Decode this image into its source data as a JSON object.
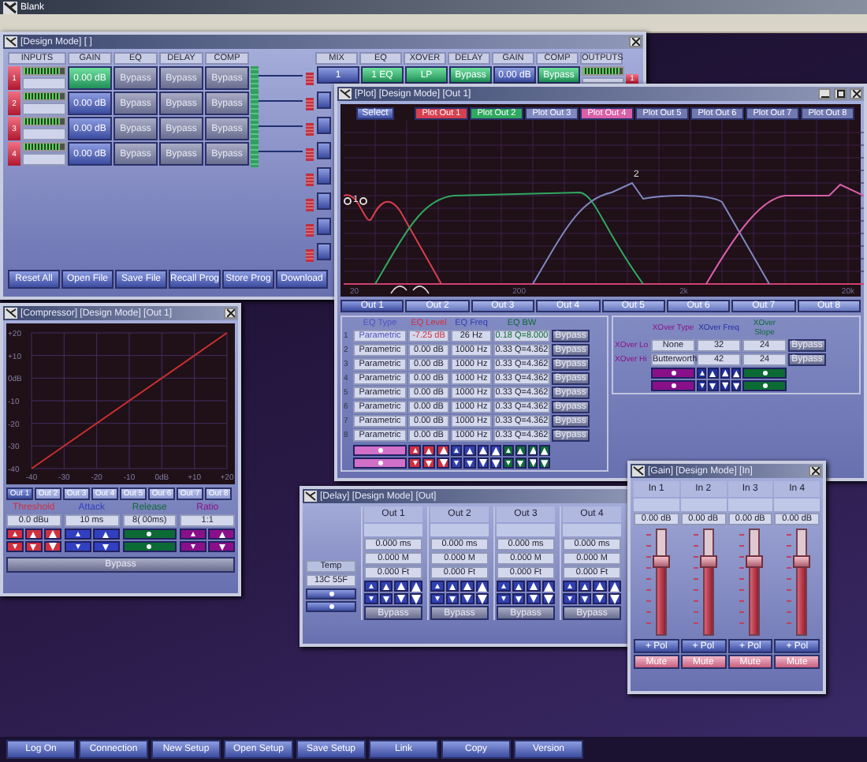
{
  "app_title": "Blank",
  "design": {
    "title": "[Design Mode] [ ]",
    "input_headers": [
      "INPUTS",
      "GAIN",
      "EQ",
      "DELAY",
      "COMP"
    ],
    "output_headers": [
      "MIX",
      "EQ",
      "XOVER",
      "DELAY",
      "GAIN",
      "COMP",
      "OUTPUTS"
    ],
    "inputs": [
      {
        "number": "1",
        "level": 0.9,
        "gain": "0.00 dB",
        "selected": true,
        "eq": "Bypass",
        "delay": "Bypass",
        "comp": "Bypass"
      },
      {
        "number": "2",
        "level": 0.9,
        "gain": "0.00 dB",
        "selected": false,
        "eq": "Bypass",
        "delay": "Bypass",
        "comp": "Bypass"
      },
      {
        "number": "3",
        "level": 0.9,
        "gain": "0.00 dB",
        "selected": false,
        "eq": "Bypass",
        "delay": "Bypass",
        "comp": "Bypass"
      },
      {
        "number": "4",
        "level": 0.9,
        "gain": "0.00 dB",
        "selected": false,
        "eq": "Bypass",
        "delay": "Bypass",
        "comp": "Bypass"
      }
    ],
    "output": {
      "mix": "1",
      "eq": "1 EQ",
      "xover": "LP",
      "delay": "Bypass",
      "gain": "0.00 dB",
      "comp": "Bypass",
      "level": 0.9,
      "number": "1"
    },
    "buttons": [
      "Reset All",
      "Open File",
      "Save File",
      "Recall Prog",
      "Store Prog",
      "Download"
    ]
  },
  "plot": {
    "title": "[Plot] [Design Mode] [Out 1]",
    "select": "Select",
    "plot_buttons": [
      {
        "label": "Plot Out 1",
        "color": "#d84050"
      },
      {
        "label": "Plot Out 2",
        "color": "#30a860"
      },
      {
        "label": "Plot Out 3",
        "color": "#8088c0"
      },
      {
        "label": "Plot Out 4",
        "color": "#d860a8"
      },
      {
        "label": "Plot Out 5",
        "color": "#7078b0"
      },
      {
        "label": "Plot Out 6",
        "color": "#7078b0"
      },
      {
        "label": "Plot Out 7",
        "color": "#7078b0"
      },
      {
        "label": "Plot Out 8",
        "color": "#7078b0"
      }
    ],
    "x_labels": [
      "20",
      "200",
      "2k",
      "20k"
    ],
    "point_labels": [
      "1",
      "2"
    ],
    "out_tabs": [
      {
        "label": "Out 1",
        "selected": true
      },
      {
        "label": "Out 2",
        "selected": false
      },
      {
        "label": "Out 3",
        "selected": false
      },
      {
        "label": "Out 4",
        "selected": false
      },
      {
        "label": "Out 5",
        "selected": false
      },
      {
        "label": "Out 6",
        "selected": false
      },
      {
        "label": "Out 7",
        "selected": false
      },
      {
        "label": "Out 8",
        "selected": false
      }
    ],
    "eq_headers": [
      {
        "label": "EQ Type",
        "color": "#5050c0"
      },
      {
        "label": "EQ Level",
        "color": "#d03040"
      },
      {
        "label": "EQ Freq",
        "color": "#3040b0"
      },
      {
        "label": "EQ BW",
        "color": "#0c6a34"
      }
    ],
    "eq_rows": [
      {
        "number": "1",
        "type": "Parametric",
        "level": "-7.25 dB",
        "freq": "26 Hz",
        "bw": "0.18 Q=8.000",
        "bypass": "Bypass",
        "selected": true
      },
      {
        "number": "2",
        "type": "Parametric",
        "level": "0.00 dB",
        "freq": "1000 Hz",
        "bw": "0.33 Q=4.362",
        "bypass": "Bypass",
        "selected": false
      },
      {
        "number": "3",
        "type": "Parametric",
        "level": "0.00 dB",
        "freq": "1000 Hz",
        "bw": "0.33 Q=4.362",
        "bypass": "Bypass",
        "selected": false
      },
      {
        "number": "4",
        "type": "Parametric",
        "level": "0.00 dB",
        "freq": "1000 Hz",
        "bw": "0.33 Q=4.362",
        "bypass": "Bypass",
        "selected": false
      },
      {
        "number": "5",
        "type": "Parametric",
        "level": "0.00 dB",
        "freq": "1000 Hz",
        "bw": "0.33 Q=4.362",
        "bypass": "Bypass",
        "selected": false
      },
      {
        "number": "6",
        "type": "Parametric",
        "level": "0.00 dB",
        "freq": "1000 Hz",
        "bw": "0.33 Q=4.362",
        "bypass": "Bypass",
        "selected": false
      },
      {
        "number": "7",
        "type": "Parametric",
        "level": "0.00 dB",
        "freq": "1000 Hz",
        "bw": "0.33 Q=4.362",
        "bypass": "Bypass",
        "selected": false
      },
      {
        "number": "8",
        "type": "Parametric",
        "level": "0.00 dB",
        "freq": "1000 Hz",
        "bw": "0.33 Q=4.362",
        "bypass": "Bypass",
        "selected": false
      }
    ],
    "xover_headers": [
      {
        "label": "XOver Type",
        "color": "#8a108a"
      },
      {
        "label": "XOver Freq",
        "color": "#2030a0"
      },
      {
        "label": "XOver Slope",
        "color": "#0c6a34"
      }
    ],
    "xover_rows": [
      {
        "label": "XOver Lo",
        "type": "None",
        "freq": "32",
        "slope": "24",
        "bypass": "Bypass"
      },
      {
        "label": "XOver Hi",
        "type": "Butterworth",
        "freq": "42",
        "slope": "24",
        "bypass": "Bypass"
      }
    ]
  },
  "compressor": {
    "title": "[Compressor] [Design Mode] [Out 1]",
    "chart_data": {
      "type": "line",
      "grid": true,
      "x": [
        -40,
        20
      ],
      "series": [
        {
          "color": "#c83030",
          "values": [
            -40,
            20
          ]
        }
      ],
      "xlim": [
        -40,
        20
      ],
      "ylim": [
        -40,
        20
      ],
      "xticks": [
        -40,
        -30,
        -20,
        -10,
        {
          "value": 0,
          "label": "0dB"
        },
        {
          "value": 10,
          "label": "+10"
        },
        {
          "value": 20,
          "label": "+20"
        }
      ],
      "yticks": [
        {
          "value": 20,
          "label": "+20"
        },
        {
          "value": 10,
          "label": "+10"
        },
        {
          "value": 0,
          "label": "0dB"
        },
        -10,
        -20,
        -30,
        -40
      ]
    },
    "out_tabs": [
      {
        "label": "Out 1",
        "selected": true
      },
      {
        "label": "Out 2",
        "selected": false
      },
      {
        "label": "Out 3",
        "selected": false
      },
      {
        "label": "Out 4",
        "selected": false
      },
      {
        "label": "Out 5",
        "selected": false
      },
      {
        "label": "Out 6",
        "selected": false
      },
      {
        "label": "Out 7",
        "selected": false
      },
      {
        "label": "Out 8",
        "selected": false
      }
    ],
    "params": [
      {
        "label": "Threshold",
        "value": "0.0 dBu",
        "color": "#d03040"
      },
      {
        "label": "Attack",
        "value": "10 ms",
        "color": "#3040c0"
      },
      {
        "label": "Release",
        "value": "8( 00ms)",
        "color": "#0c6a34"
      },
      {
        "label": "Ratio",
        "value": "1:1",
        "color": "#8a108a"
      }
    ],
    "bypass": "Bypass"
  },
  "delay": {
    "title": "[Delay] [Design Mode] [Out]",
    "temp_label": "Temp",
    "temp_value": "13C 55F",
    "channels": [
      {
        "label": "Out 1",
        "ms": "0.000 ms",
        "m": "0.000 M",
        "ft": "0.000 Ft",
        "bypass": "Bypass"
      },
      {
        "label": "Out 2",
        "ms": "0.000 ms",
        "m": "0.000 M",
        "ft": "0.000 Ft",
        "bypass": "Bypass"
      },
      {
        "label": "Out 3",
        "ms": "0.000 ms",
        "m": "0.000 M",
        "ft": "0.000 Ft",
        "bypass": "Bypass"
      },
      {
        "label": "Out 4",
        "ms": "0.000 ms",
        "m": "0.000 M",
        "ft": "0.000 Ft",
        "bypass": "Bypass"
      }
    ]
  },
  "gain": {
    "title": "[Gain] [Design Mode] [In]",
    "channels": [
      {
        "label": "In 1",
        "value": "0.00 dB",
        "level": 0.7,
        "pol": "+ Pol",
        "mute": "Mute"
      },
      {
        "label": "In 2",
        "value": "0.00 dB",
        "level": 0.7,
        "pol": "+ Pol",
        "mute": "Mute"
      },
      {
        "label": "In 3",
        "value": "0.00 dB",
        "level": 0.7,
        "pol": "+ Pol",
        "mute": "Mute"
      },
      {
        "label": "In 4",
        "value": "0.00 dB",
        "level": 0.7,
        "pol": "+ Pol",
        "mute": "Mute"
      }
    ]
  },
  "taskbar": [
    "Log On",
    "Connection",
    "New Setup",
    "Open Setup",
    "Save Setup",
    "Link",
    "Copy",
    "Version"
  ]
}
